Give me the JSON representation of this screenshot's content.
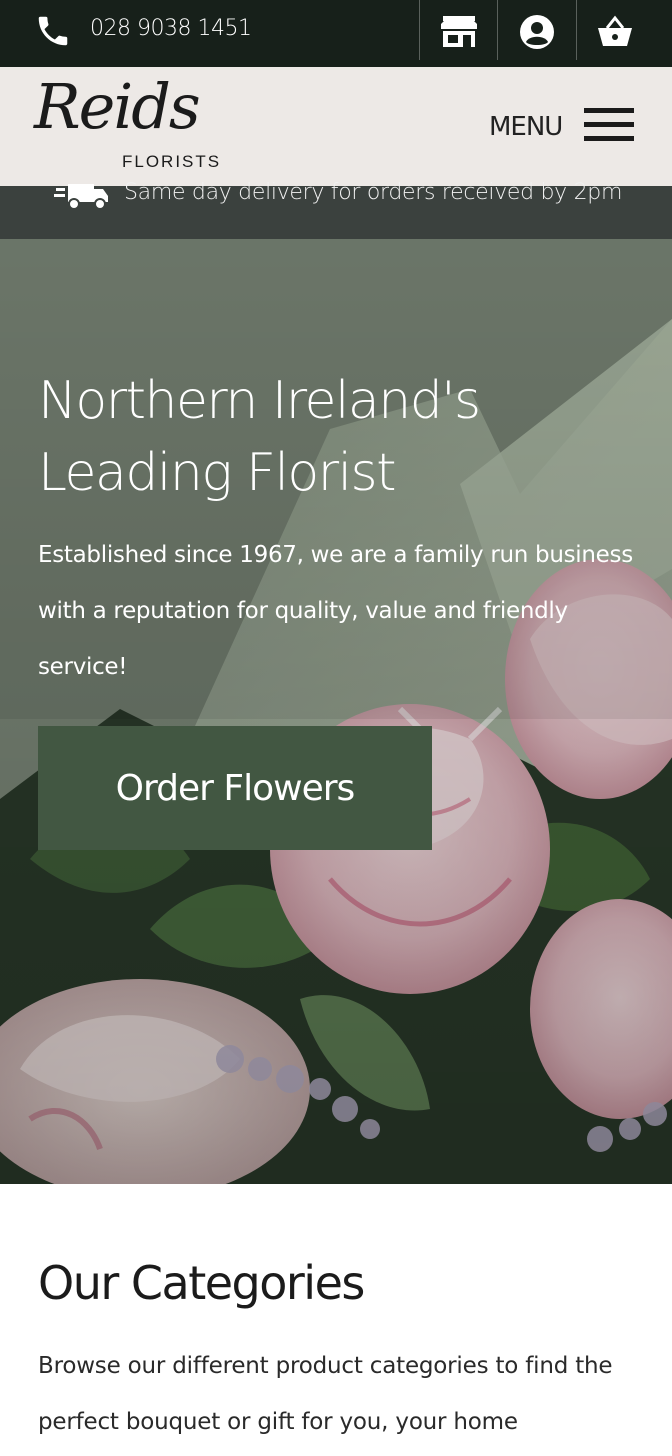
{
  "topbar": {
    "phone": "028 9038 1451",
    "icons": [
      "phone-icon",
      "store-icon",
      "account-icon",
      "basket-icon"
    ]
  },
  "header": {
    "logo_script": "Reids",
    "logo_sub": "FLORISTS",
    "menu_label": "MENU"
  },
  "delivery": {
    "text": "Same day delivery for orders received by 2pm",
    "icon": "truck-icon"
  },
  "hero": {
    "title_line1": "Northern Ireland's",
    "title_line2": "Leading Florist",
    "description": "Established since 1967, we are a family run business with a reputation for quality, value and friendly service!",
    "button_label": "Order Flowers"
  },
  "categories": {
    "title": "Our Categories",
    "description": "Browse our different product categories to find the perfect bouquet or gift for you, your home"
  },
  "colors": {
    "topbar_bg": "#17201a",
    "header_bg": "#ede9e6",
    "delivery_bg": "#3b413e",
    "button_bg": "#425742"
  }
}
